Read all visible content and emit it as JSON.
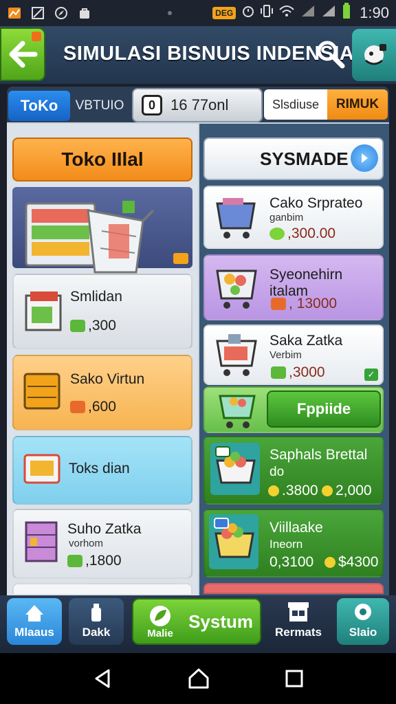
{
  "status_bar": {
    "badge": "DEG",
    "time": "1:90"
  },
  "header": {
    "title": "SIMULASI BISNUIS INDENSIA"
  },
  "tabs": {
    "tab1": "ToKo",
    "tab2": "VBTUIO",
    "counter_icon": "0",
    "counter": "16 77onl",
    "tab3": "Slsdiuse",
    "tab4": "RIMUK"
  },
  "left": {
    "header": "Toko IIlal",
    "cards": [
      {
        "name": "Smlidan",
        "price": ",300"
      },
      {
        "name": "Sako Virtun",
        "price": ",600"
      },
      {
        "name": "Toks dian",
        "price": ""
      },
      {
        "name": "Suho Zatka",
        "sub": "vorhom",
        "price": ",1800"
      }
    ]
  },
  "right": {
    "header": "SYSMADE",
    "cards": [
      {
        "name": "Cako Srprateo",
        "sub": "ganbim",
        "price": ",300.00"
      },
      {
        "name": "Syeonehirn italam",
        "price": ", 13000"
      },
      {
        "name": "Saka Zatka",
        "sub": "Verbim",
        "price": ",3000"
      },
      {
        "button": "Fppiide"
      },
      {
        "name": "Saphals Brettal",
        "sub": "do",
        "price1": ".3800",
        "price2": "2,000"
      },
      {
        "name": "Viillaake",
        "sub": "Ineorn",
        "price1": "0,3100",
        "price2": "$4300"
      }
    ]
  },
  "bottom_nav": {
    "items": [
      "Mlaaus",
      "Dakk",
      "Malie",
      "Systum",
      "Rermats",
      "Slaio"
    ]
  },
  "colors": {
    "accent_green": "#4fa519",
    "accent_orange": "#f28c1a",
    "accent_blue": "#1663c4"
  }
}
